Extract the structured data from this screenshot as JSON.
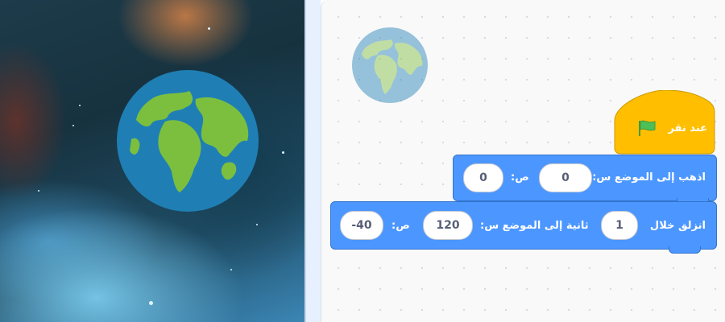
{
  "stage": {
    "backdrop": "space-nebula",
    "sprite": "earth-globe"
  },
  "workspace": {
    "sprite_thumbnail": "earth-globe",
    "scripts": [
      {
        "hat": {
          "label": "عند نقر",
          "icon": "green-flag-icon",
          "color": "#ffbf00"
        },
        "blocks": [
          {
            "opcode": "go to x y",
            "label": "اذهب إلى الموضع س:",
            "y_label": "ص:",
            "x_value": "0",
            "y_value": "0",
            "color": "#4c97ff"
          },
          {
            "opcode": "glide secs to x y",
            "label_start": "انزلق خلال",
            "secs_value": "1",
            "label_mid": "ثانية إلى الموضع س:",
            "x_value": "120",
            "y_label": "ص:",
            "y_value": "-40",
            "color": "#4c97ff"
          }
        ]
      }
    ]
  }
}
